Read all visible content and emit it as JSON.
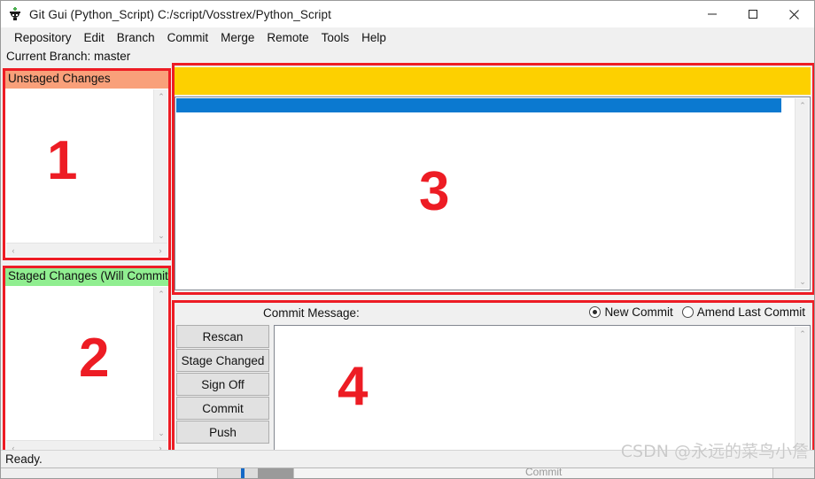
{
  "window": {
    "title": "Git Gui (Python_Script) C:/script/Vosstrex/Python_Script",
    "icon": "git-gui-icon",
    "controls": {
      "minimize": "—",
      "maximize": "☐",
      "close": "✕"
    }
  },
  "menubar": {
    "items": [
      {
        "label": "Repository"
      },
      {
        "label": "Edit"
      },
      {
        "label": "Branch"
      },
      {
        "label": "Commit"
      },
      {
        "label": "Merge"
      },
      {
        "label": "Remote"
      },
      {
        "label": "Tools"
      },
      {
        "label": "Help"
      }
    ]
  },
  "branch": {
    "label": "Current Branch: master"
  },
  "panels": {
    "unstaged": {
      "header": "Unstaged Changes",
      "header_color": "#F9A07A",
      "number": "1"
    },
    "staged": {
      "header": "Staged Changes (Will Commit)",
      "header_color": "#90EE90",
      "number": "2"
    },
    "diff": {
      "number": "3",
      "highlight_top_color": "#FDD000",
      "highlight_row_color": "#0B79D0"
    },
    "commit": {
      "number": "4"
    }
  },
  "commit_area": {
    "message_label": "Commit Message:",
    "radios": [
      {
        "label": "New Commit",
        "checked": true
      },
      {
        "label": "Amend Last Commit",
        "checked": false
      }
    ],
    "message_value": "",
    "buttons": [
      {
        "label": "Rescan"
      },
      {
        "label": "Stage Changed"
      },
      {
        "label": "Sign Off"
      },
      {
        "label": "Commit"
      },
      {
        "label": "Push"
      }
    ]
  },
  "statusbar": {
    "text": "Ready."
  },
  "background_window": {
    "commit_label": "Commit"
  },
  "watermark": {
    "text": "CSDN @永远的菜鸟小詹"
  },
  "scroll_icons": {
    "up": "⌃",
    "down": "⌄",
    "left": "‹",
    "right": "›"
  },
  "colors": {
    "overlay_red": "#ED1C24",
    "window_bg": "#F0F0F0"
  }
}
